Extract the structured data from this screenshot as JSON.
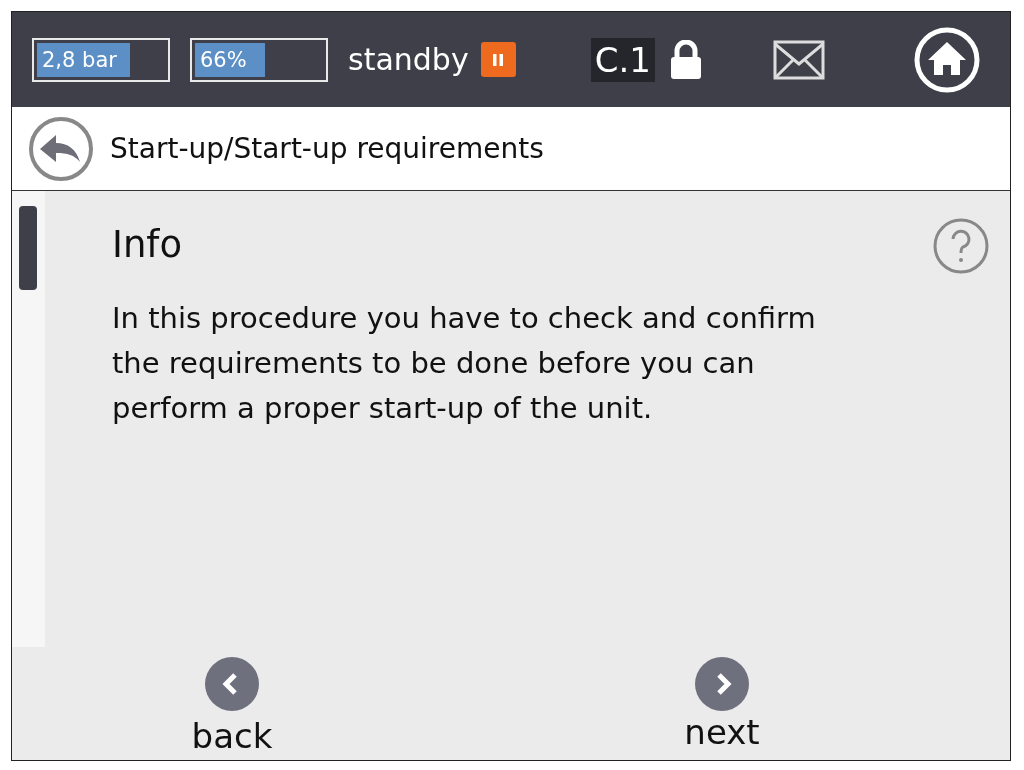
{
  "status_bar": {
    "gauges": [
      {
        "reading": "2,8 bar",
        "level": 0.74
      },
      {
        "reading": "66%",
        "level": 0.57
      }
    ],
    "mode": "standby",
    "paused": true,
    "user_level": "C.1",
    "locked": true
  },
  "breadcrumb": "Start-up/Start-up requirements",
  "info": {
    "title": "Info",
    "text": "In this procedure you have to check and confirm the requirements to be done before you can perform a proper start-up of the unit."
  },
  "nav": {
    "back": "back",
    "next": "next"
  }
}
